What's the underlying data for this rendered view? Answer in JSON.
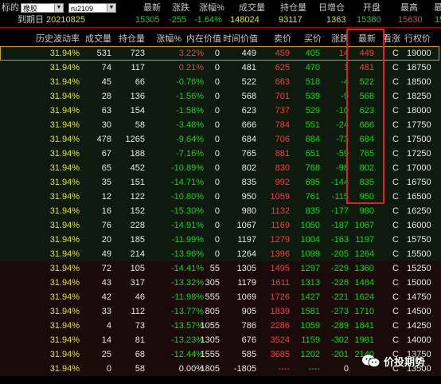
{
  "header": {
    "label_subject": "标的",
    "label_expiry": "到期日",
    "expiry": "20210825",
    "select_underlying": "橡胶",
    "select_contract": "ru2109",
    "quote_titles": [
      "最新",
      "涨跌",
      "涨幅%",
      "成交量",
      "持仓量",
      "日增仓",
      "开盘",
      "最高",
      "最"
    ],
    "quote_values": [
      "15305",
      "-255",
      "-1.64%",
      "148024",
      "93117",
      "1363",
      "15380",
      "15630",
      "15"
    ]
  },
  "columns": [
    "历史波动率",
    "成交量",
    "持仓量",
    "涨幅%",
    "内在价值",
    "时间价值",
    "卖价",
    "买价",
    "涨跌",
    "最新",
    "看涨",
    "行权价"
  ],
  "rows": [
    {
      "hv": "31.94%",
      "vol": "531",
      "oi": "723",
      "chg_pct": "3.22%",
      "intrinsic": "0",
      "time_value": "449",
      "ask": "459",
      "bid": "405",
      "chg": "14",
      "last": "449",
      "type": "C",
      "strike": "19000"
    },
    {
      "hv": "31.94%",
      "vol": "74",
      "oi": "117",
      "chg_pct": "0.21%",
      "intrinsic": "0",
      "time_value": "481",
      "ask": "625",
      "bid": "470",
      "chg": "1",
      "last": "481",
      "type": "C",
      "strike": "18750"
    },
    {
      "hv": "31.94%",
      "vol": "45",
      "oi": "66",
      "chg_pct": "-0.76%",
      "intrinsic": "0",
      "time_value": "522",
      "ask": "663",
      "bid": "518",
      "chg": "-4",
      "last": "522",
      "type": "C",
      "strike": "18500"
    },
    {
      "hv": "31.94%",
      "vol": "28",
      "oi": "136",
      "chg_pct": "-1.56%",
      "intrinsic": "0",
      "time_value": "568",
      "ask": "701",
      "bid": "539",
      "chg": "-9",
      "last": "568",
      "type": "C",
      "strike": "18250"
    },
    {
      "hv": "31.94%",
      "vol": "63",
      "oi": "154",
      "chg_pct": "-1.58%",
      "intrinsic": "0",
      "time_value": "623",
      "ask": "737",
      "bid": "529",
      "chg": "-10",
      "last": "623",
      "type": "C",
      "strike": "18000"
    },
    {
      "hv": "31.94%",
      "vol": "30",
      "oi": "58",
      "chg_pct": "-3.48%",
      "intrinsic": "0",
      "time_value": "666",
      "ask": "784",
      "bid": "551",
      "chg": "-24",
      "last": "666",
      "type": "C",
      "strike": "17750"
    },
    {
      "hv": "31.94%",
      "vol": "478",
      "oi": "1265",
      "chg_pct": "-9.64%",
      "intrinsic": "0",
      "time_value": "684",
      "ask": "706",
      "bid": "684",
      "chg": "-73",
      "last": "684",
      "type": "C",
      "strike": "17500"
    },
    {
      "hv": "31.94%",
      "vol": "67",
      "oi": "188",
      "chg_pct": "-7.16%",
      "intrinsic": "0",
      "time_value": "765",
      "ask": "881",
      "bid": "651",
      "chg": "-59",
      "last": "765",
      "type": "C",
      "strike": "17250"
    },
    {
      "hv": "31.94%",
      "vol": "65",
      "oi": "452",
      "chg_pct": "-10.89%",
      "intrinsic": "0",
      "time_value": "802",
      "ask": "830",
      "bid": "768",
      "chg": "-98",
      "last": "802",
      "type": "C",
      "strike": "17000"
    },
    {
      "hv": "31.94%",
      "vol": "35",
      "oi": "151",
      "chg_pct": "-14.71%",
      "intrinsic": "0",
      "time_value": "835",
      "ask": "992",
      "bid": "695",
      "chg": "-144",
      "last": "835",
      "type": "C",
      "strike": "16750"
    },
    {
      "hv": "31.94%",
      "vol": "12",
      "oi": "122",
      "chg_pct": "-10.80%",
      "intrinsic": "0",
      "time_value": "950",
      "ask": "1059",
      "bid": "761",
      "chg": "-115",
      "last": "950",
      "type": "C",
      "strike": "16500"
    },
    {
      "hv": "31.94%",
      "vol": "16",
      "oi": "152",
      "chg_pct": "-15.30%",
      "intrinsic": "0",
      "time_value": "980",
      "ask": "1132",
      "bid": "835",
      "chg": "-177",
      "last": "980",
      "type": "C",
      "strike": "16250"
    },
    {
      "hv": "31.94%",
      "vol": "76",
      "oi": "228",
      "chg_pct": "-14.91%",
      "intrinsic": "0",
      "time_value": "1067",
      "ask": "1169",
      "bid": "1050",
      "chg": "-187",
      "last": "1067",
      "type": "C",
      "strike": "16000"
    },
    {
      "hv": "31.94%",
      "vol": "20",
      "oi": "185",
      "chg_pct": "-11.99%",
      "intrinsic": "0",
      "time_value": "1197",
      "ask": "1279",
      "bid": "1004",
      "chg": "-163",
      "last": "1197",
      "type": "C",
      "strike": "15750"
    },
    {
      "hv": "31.94%",
      "vol": "49",
      "oi": "214",
      "chg_pct": "-13.96%",
      "intrinsic": "0",
      "time_value": "1264",
      "ask": "1396",
      "bid": "1099",
      "chg": "-205",
      "last": "1264",
      "type": "C",
      "strike": "15500"
    },
    {
      "hv": "31.94%",
      "vol": "72",
      "oi": "105",
      "chg_pct": "-14.41%",
      "intrinsic": "55",
      "time_value": "1305",
      "ask": "1495",
      "bid": "1297",
      "chg": "-229",
      "last": "1360",
      "type": "C",
      "strike": "15250"
    },
    {
      "hv": "31.94%",
      "vol": "43",
      "oi": "317",
      "chg_pct": "-13.32%",
      "intrinsic": "305",
      "time_value": "1179",
      "ask": "1611",
      "bid": "1313",
      "chg": "-228",
      "last": "1484",
      "type": "C",
      "strike": "15000"
    },
    {
      "hv": "31.94%",
      "vol": "42",
      "oi": "46",
      "chg_pct": "-11.98%",
      "intrinsic": "555",
      "time_value": "1069",
      "ask": "1726",
      "bid": "1427",
      "chg": "-221",
      "last": "1624",
      "type": "C",
      "strike": "14750"
    },
    {
      "hv": "31.94%",
      "vol": "33",
      "oi": "112",
      "chg_pct": "-13.77%",
      "intrinsic": "805",
      "time_value": "905",
      "ask": "1839",
      "bid": "1581",
      "chg": "-273",
      "last": "1710",
      "type": "C",
      "strike": "14500"
    },
    {
      "hv": "31.94%",
      "vol": "4",
      "oi": "73",
      "chg_pct": "-13.57%",
      "intrinsic": "1055",
      "time_value": "786",
      "ask": "2286",
      "bid": "1059",
      "chg": "-289",
      "last": "1841",
      "type": "C",
      "strike": "14250"
    },
    {
      "hv": "31.94%",
      "vol": "14",
      "oi": "81",
      "chg_pct": "-13.23%",
      "intrinsic": "1305",
      "time_value": "676",
      "ask": "3524",
      "bid": "1159",
      "chg": "-302",
      "last": "1981",
      "type": "C",
      "strike": "14000"
    },
    {
      "hv": "31.94%",
      "vol": "25",
      "oi": "68",
      "chg_pct": "-12.44%",
      "intrinsic": "1555",
      "time_value": "585",
      "ask": "3685",
      "bid": "1202",
      "chg": "-201",
      "last": "2140",
      "type": "C",
      "strike": "13750"
    },
    {
      "hv": "31.94%",
      "vol": "0",
      "oi": "58",
      "chg_pct": "0.00%",
      "intrinsic": "1805",
      "time_value": "-1805",
      "ask": "----",
      "bid": "----",
      "chg": "0",
      "last": "",
      "type": "C",
      "strike": "13500"
    }
  ],
  "watermark": {
    "text": "价投期势",
    "icon": "wechat-icon"
  },
  "colors": {
    "up": "#ff3b3b",
    "down": "#00e600",
    "neutral": "#e8e8e8",
    "hv": "#e6e600",
    "highlight_box": "#e02020",
    "itm_bg": "#1a0a0a",
    "otm_bg": "#0d1a0d"
  }
}
